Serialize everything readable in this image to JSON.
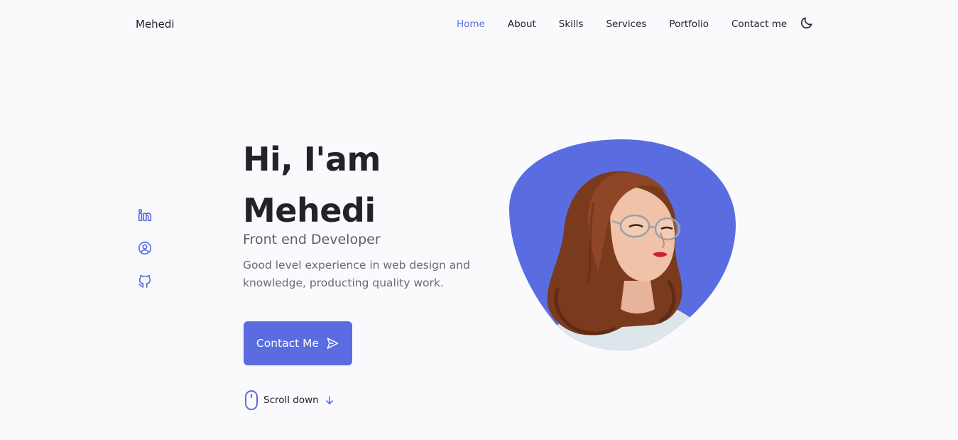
{
  "brand": {
    "name": "Mehedi"
  },
  "nav": {
    "items": [
      {
        "label": "Home",
        "active": true
      },
      {
        "label": "About",
        "active": false
      },
      {
        "label": "Skills",
        "active": false
      },
      {
        "label": "Services",
        "active": false
      },
      {
        "label": "Portfolio",
        "active": false
      },
      {
        "label": "Contact me",
        "active": false
      }
    ],
    "theme_icon": "moon-icon"
  },
  "social": [
    {
      "icon": "linkedin-icon"
    },
    {
      "icon": "dribbble-icon"
    },
    {
      "icon": "github-icon"
    }
  ],
  "hero": {
    "greeting_line1": "Hi, I'am",
    "greeting_line2": "Mehedi",
    "role": "Front end Developer",
    "description": "Good level experience in web design and knowledge, producting quality work.",
    "cta_label": "Contact Me",
    "cta_icon": "send-icon",
    "scroll_label": "Scroll down"
  },
  "colors": {
    "accent": "#5a6de0",
    "background": "#fafafd",
    "text": "#23222a"
  }
}
